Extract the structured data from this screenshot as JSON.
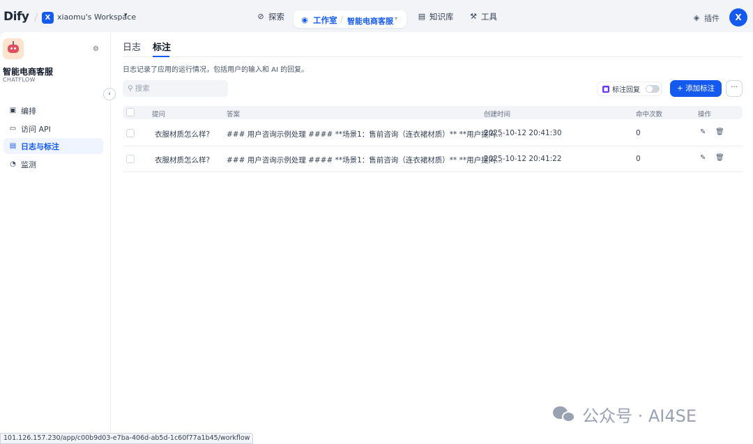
{
  "topbar": {
    "logo_text": "Dify",
    "workspace_badge": "X",
    "workspace_name": "xiaomu's Workspace",
    "nav": {
      "explore": "探索",
      "studio": "工作室",
      "current_app": "智能电商客服",
      "knowledge": "知识库",
      "tools": "工具"
    },
    "plugins": "插件",
    "avatar": "X"
  },
  "sidebar": {
    "app_name": "智能电商客服",
    "app_type": "CHATFLOW",
    "items": [
      {
        "label": "编排",
        "icon": "layout-icon"
      },
      {
        "label": "访问 API",
        "icon": "terminal-icon"
      },
      {
        "label": "日志与标注",
        "icon": "file-text-icon"
      },
      {
        "label": "监测",
        "icon": "dashboard-icon"
      }
    ]
  },
  "main": {
    "tabs": [
      "日志",
      "标注"
    ],
    "active_tab": "标注",
    "description": "日志记录了应用的运行情况，包括用户的输入和 AI 的回复。",
    "search_placeholder": "搜索",
    "reply_toggle_label": "标注回复",
    "add_button": "添加标注",
    "more_button": "···",
    "columns": [
      "提问",
      "答案",
      "创建时间",
      "命中次数",
      "操作"
    ],
    "rows": [
      {
        "question": "衣服材质怎么样?",
        "answer": "### 用户咨询示例处理 #### **场景1：售前咨询（连衣裙材质）** **用户提问...",
        "created": "2025-10-12 20:41:30",
        "hits": "0"
      },
      {
        "question": "衣服材质怎么样?",
        "answer": "### 用户咨询示例处理 #### **场景1：售前咨询（连衣裙材质）** **用户提问...",
        "created": "2025-10-12 20:41:22",
        "hits": "0"
      }
    ]
  },
  "status_url": "101.126.157.230/app/c00b9d03-e7ba-406d-ab5d-1c60f77a1b45/workflow",
  "watermark": "公众号 · AI4SE",
  "colors": {
    "accent": "#155aef",
    "background": "#f2f4f7"
  }
}
